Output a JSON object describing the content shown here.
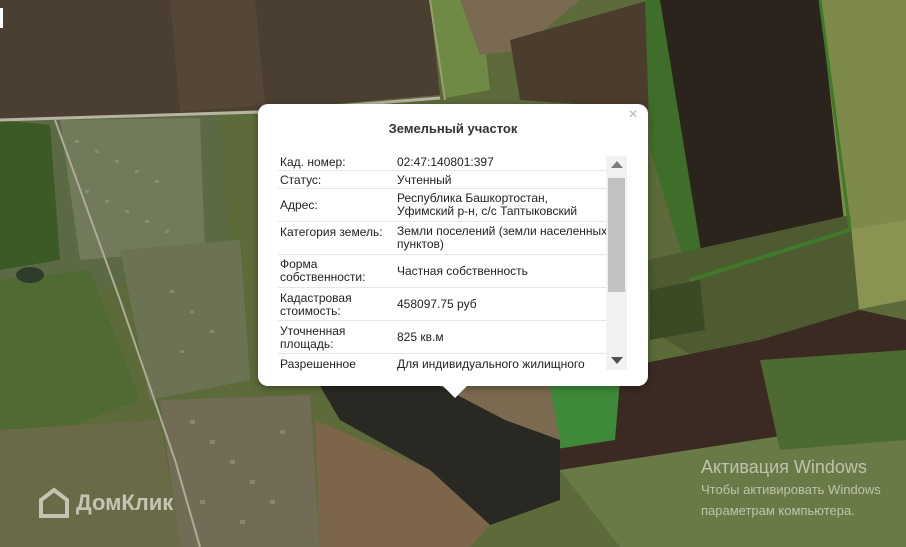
{
  "popup": {
    "title": "Земельный участок",
    "close": "×",
    "rows": [
      {
        "label": "Кад. номер:",
        "value": "02:47:140801:397"
      },
      {
        "label": "Статус:",
        "value": "Учтенный"
      },
      {
        "label": "Адрес:",
        "value": "Республика Башкортостан, Уфимский р-н, с/с Таптыковский"
      },
      {
        "label": "Категория земель:",
        "value": "Земли поселений (земли населенных пунктов)"
      },
      {
        "label": "Форма собственности:",
        "value": "Частная собственность"
      },
      {
        "label": "Кадастровая стоимость:",
        "value": "458097.75 руб"
      },
      {
        "label": "Уточненная площадь:",
        "value": "825 кв.м"
      },
      {
        "label": "Разрешенное",
        "value": "Для индивидуального жилищного"
      }
    ]
  },
  "watermark": {
    "text": "ДомКлик"
  },
  "activation": {
    "line1": "Активация Windows",
    "line2": "Чтобы активировать Windows",
    "line3": "параметрам компьютера."
  }
}
